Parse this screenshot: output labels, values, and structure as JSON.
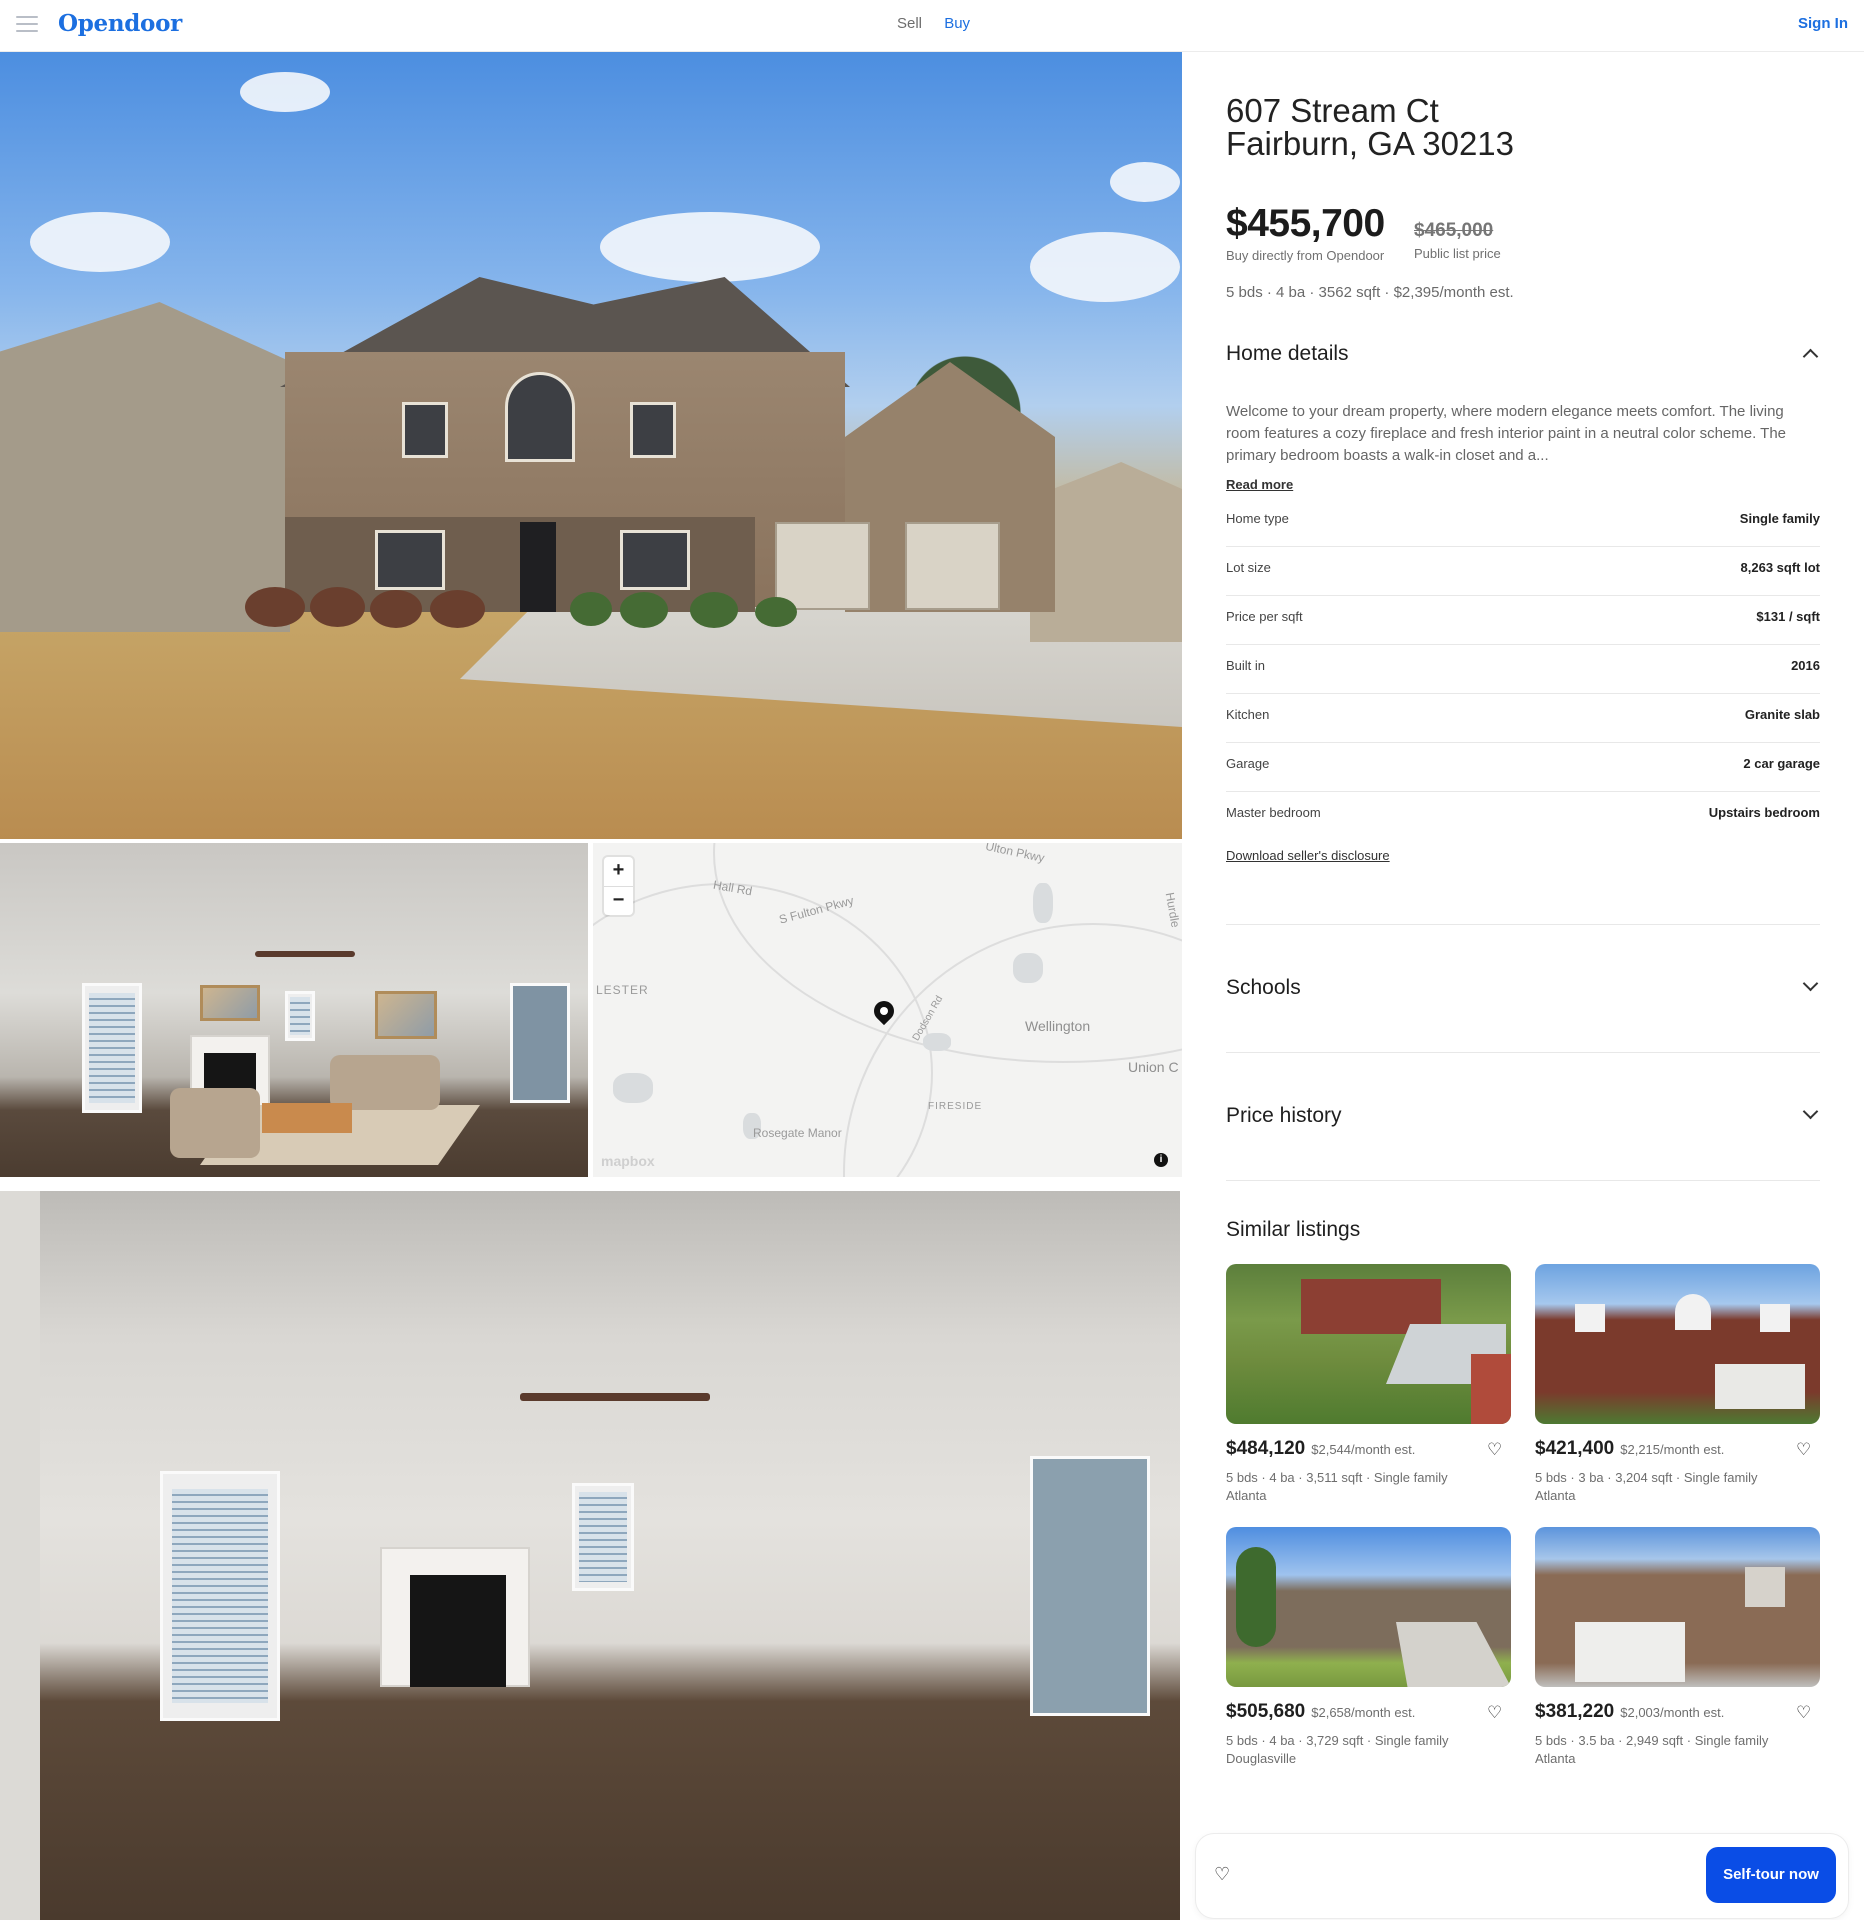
{
  "header": {
    "logo": "Opendoor",
    "nav": {
      "sell": "Sell",
      "buy": "Buy"
    },
    "sign_in": "Sign In"
  },
  "map": {
    "labels": [
      "Hall Rd",
      "S Fulton Pkwy",
      "Ulton Pkwy",
      "Hurdle",
      "LESTER",
      "Wellington",
      "Union C",
      "Dodson Rd",
      "FIRESIDE",
      "Rosegate Manor"
    ],
    "attribution": "mapbox",
    "zoom_in": "+",
    "zoom_out": "−"
  },
  "listing": {
    "address_line1": "607 Stream Ct",
    "address_line2": "Fairburn, GA 30213",
    "price": "$455,700",
    "price_note": "Buy directly from Opendoor",
    "list_price": "$465,000",
    "list_price_note": "Public list price",
    "summary": "5 bds · 4 ba · 3562 sqft · $2,395/month est."
  },
  "home_details": {
    "title": "Home details",
    "description": "Welcome to your dream property, where modern elegance meets comfort. The living room features a cozy fireplace and fresh interior paint in a neutral color scheme. The primary bedroom boasts a walk-in closet and a...",
    "read_more": "Read more",
    "rows": [
      {
        "key": "Home type",
        "value": "Single family"
      },
      {
        "key": "Lot size",
        "value": "8,263 sqft lot"
      },
      {
        "key": "Price per sqft",
        "value": "$131 / sqft"
      },
      {
        "key": "Built in",
        "value": "2016"
      },
      {
        "key": "Kitchen",
        "value": "Granite slab"
      },
      {
        "key": "Garage",
        "value": "2 car garage"
      },
      {
        "key": "Master bedroom",
        "value": "Upstairs bedroom"
      }
    ],
    "disclosure": "Download seller's disclosure"
  },
  "sections": {
    "schools": "Schools",
    "price_history": "Price history"
  },
  "similar": {
    "title": "Similar listings",
    "cards": [
      {
        "price": "$484,120",
        "month": "$2,544/month est.",
        "desc": "5 bds · 4 ba · 3,511 sqft · Single family",
        "city": "Atlanta"
      },
      {
        "price": "$421,400",
        "month": "$2,215/month est.",
        "desc": "5 bds · 3 ba · 3,204 sqft · Single family",
        "city": "Atlanta"
      },
      {
        "price": "$505,680",
        "month": "$2,658/month est.",
        "desc": "5 bds · 4 ba · 3,729 sqft · Single family",
        "city": "Douglasville"
      },
      {
        "price": "$381,220",
        "month": "$2,003/month est.",
        "desc": "5 bds · 3.5 ba · 2,949 sqft · Single family",
        "city": "Atlanta"
      }
    ]
  },
  "cta": {
    "self_tour": "Self-tour now"
  },
  "colors": {
    "brand": "#1c6fe0",
    "cta": "#0a4de6"
  },
  "icons": {
    "menu": "hamburger-icon",
    "heart": "heart-icon",
    "chevron": "chevron-icon",
    "pin": "map-pin-icon",
    "info": "info-icon"
  }
}
